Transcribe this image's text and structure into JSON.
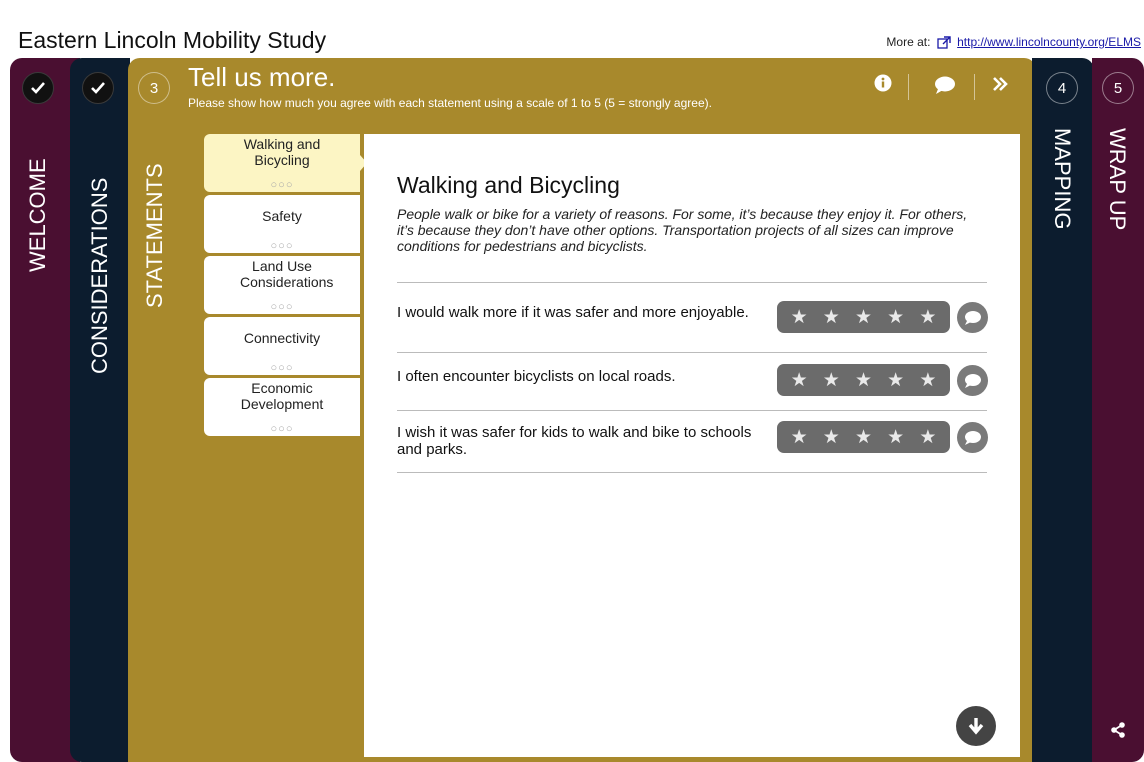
{
  "site": {
    "title": "Eastern Lincoln Mobility Study",
    "more_at_label": "More at:",
    "link": "http://www.lincolncounty.org/ELMS"
  },
  "steps": [
    {
      "label": "WELCOME",
      "status": "check"
    },
    {
      "label": "CONSIDERATIONS",
      "status": "check"
    },
    {
      "label": "STATEMENTS",
      "number": "3"
    },
    {
      "label": "MAPPING",
      "number": "4"
    },
    {
      "label": "WRAP UP",
      "number": "5"
    }
  ],
  "header": {
    "title": "Tell us more.",
    "instructions": "Please show how much you agree with each statement using a scale of 1 to 5 (5 = strongly agree).",
    "icons": [
      "info-icon",
      "comment-icon",
      "double-chevron-right-icon"
    ]
  },
  "topics": [
    {
      "label": "Walking and Bicycling",
      "dots": "○○○"
    },
    {
      "label": "Safety",
      "dots": "○○○"
    },
    {
      "label": "Land Use Considerations",
      "dots": "○○○"
    },
    {
      "label": "Connectivity",
      "dots": "○○○"
    },
    {
      "label": "Economic Development",
      "dots": "○○○"
    }
  ],
  "content": {
    "title": "Walking and Bicycling",
    "description": "People walk or bike for a variety of reasons. For some, it’s because they enjoy it. For others, it’s because they don’t have other options. Transportation projects of all sizes can improve conditions for pedestrians and bicyclists.",
    "statements": [
      {
        "text": "I would walk more if it was safer and more enjoyable.",
        "rating": 0,
        "max_rating": 5
      },
      {
        "text": "I often encounter bicyclists on local roads.",
        "rating": 0,
        "max_rating": 5
      },
      {
        "text": "I wish it was safer for kids to walk and bike to schools and parks.",
        "rating": 0,
        "max_rating": 5
      }
    ]
  },
  "colors": {
    "welcome_bg": "#4a0f31",
    "considerations_bg": "#0c1c2e",
    "active_bg": "#a8892c",
    "active_tab_bg": "#fcf5c4",
    "rating_bg": "#6b6b6b"
  }
}
